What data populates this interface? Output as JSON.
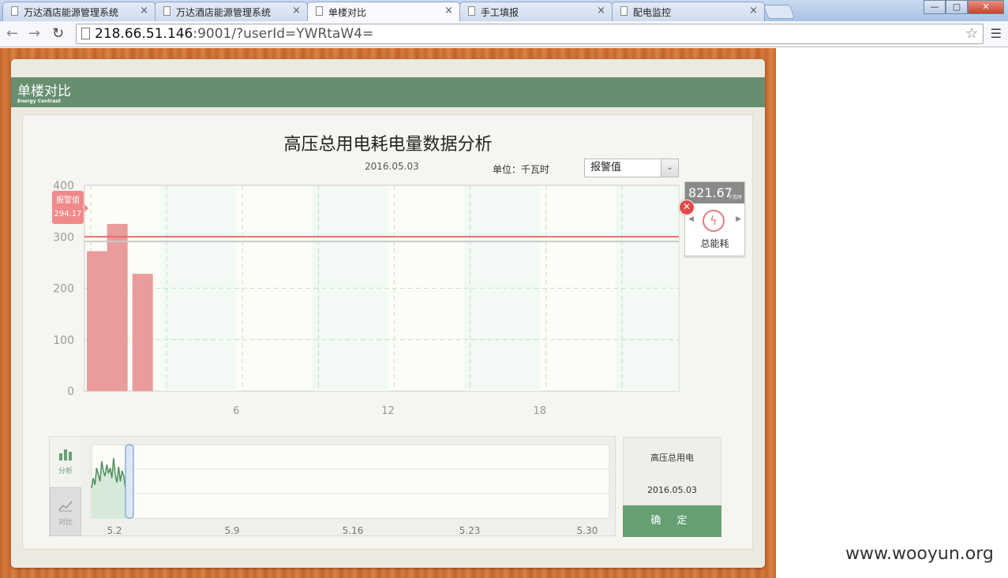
{
  "browser": {
    "tabs": [
      {
        "label": "万达酒店能源管理系统",
        "active": false
      },
      {
        "label": "万达酒店能源管理系统",
        "active": false
      },
      {
        "label": "单楼对比",
        "active": true
      },
      {
        "label": "手工填报",
        "active": false
      },
      {
        "label": "配电监控",
        "active": false
      }
    ],
    "tab_close": "×",
    "url_host": "218.66.51.146",
    "url_rest": ":9001/?userId=YWRtaW4=",
    "window_buttons": {
      "minimize": "—",
      "maximize": "▢",
      "close": "✕"
    }
  },
  "header": {
    "title": "单楼对比",
    "subtitle": "Energy Contrast"
  },
  "chart_header": {
    "title": "高压总用电耗电量数据分析",
    "date": "2016.05.03",
    "unit": "单位：千瓦时",
    "select_value": "报警值"
  },
  "alarm": {
    "label": "报警值",
    "value": "294.17"
  },
  "total": {
    "value": "821.67",
    "unit": "千瓦时",
    "label": "总能耗",
    "icon": "lightning-icon"
  },
  "close_icon": "✕",
  "bottom": {
    "tabs": [
      {
        "label": "分析",
        "icon": "bar-chart-icon"
      },
      {
        "label": "对比",
        "icon": "line-chart-icon"
      }
    ],
    "confirm_panel": {
      "title": "高压总用电",
      "date": "2016.05.03",
      "button": "确 定"
    }
  },
  "watermark": "www.wooyun.org",
  "colors": {
    "accent": "#679f75",
    "bar": "#e89c9c",
    "alarm": "#f08a8a",
    "header": "#678f6f"
  },
  "chart_data": [
    {
      "type": "bar",
      "title": "高压总用电耗电量数据分析",
      "x_ticks": [
        6,
        12,
        18
      ],
      "y_ticks": [
        0,
        100,
        200,
        300,
        400
      ],
      "ylim": [
        0,
        400
      ],
      "xlim": [
        0,
        23.5
      ],
      "grid": true,
      "series": [
        {
          "x": [
            0.5,
            1.3,
            2.3
          ],
          "values": [
            272,
            325,
            228
          ]
        }
      ],
      "reference_lines": [
        {
          "value": 294.17
        },
        {
          "value": 300
        }
      ]
    },
    {
      "type": "line",
      "x_tick_labels": [
        "5.2",
        "5.9",
        "5.16",
        "5.23",
        "5.30"
      ],
      "values": [
        40,
        55,
        45,
        70,
        60,
        50,
        80,
        65,
        58,
        75,
        62,
        70,
        55,
        85,
        60,
        48,
        72,
        50,
        66,
        58,
        40,
        30
      ],
      "ylim": [
        0,
        100
      ]
    }
  ]
}
